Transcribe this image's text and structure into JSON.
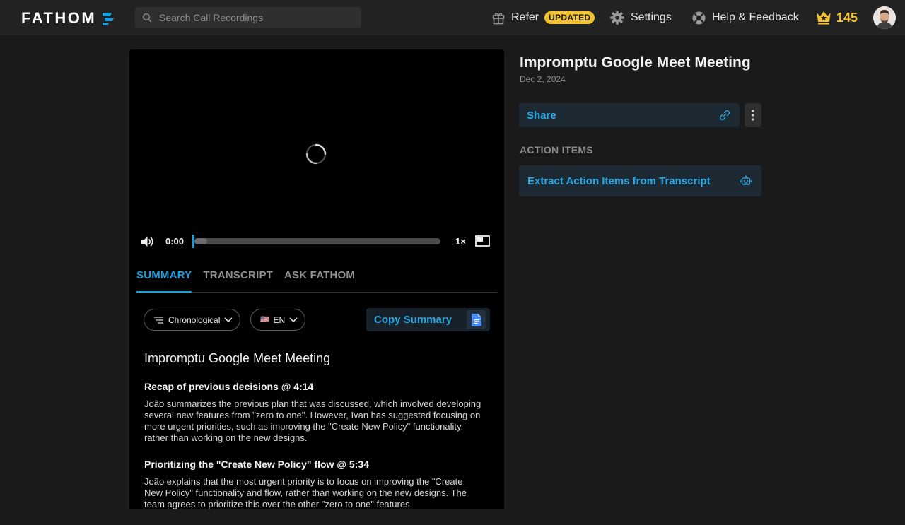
{
  "header": {
    "logo_text": "FATHOM",
    "search_placeholder": "Search Call Recordings",
    "refer_label": "Refer",
    "updated_badge": "UPDATED",
    "settings_label": "Settings",
    "help_label": "Help & Feedback",
    "points": "145"
  },
  "player": {
    "current_time": "0:00",
    "speed": "1×",
    "progress": 0
  },
  "tabs": [
    {
      "label": "SUMMARY",
      "active": true
    },
    {
      "label": "TRANSCRIPT",
      "active": false
    },
    {
      "label": "ASK FATHOM",
      "active": false
    }
  ],
  "filters": {
    "order": "Chronological",
    "language_flag": "🇺🇸",
    "language": "EN"
  },
  "copy_summary_label": "Copy Summary",
  "summary": {
    "title": "Impromptu Google Meet Meeting",
    "sections": [
      {
        "title": "Recap of previous decisions @ 4:14",
        "body": "João summarizes the previous plan that was discussed, which involved developing several new features from \"zero to one\". However, Ivan has suggested focusing on more urgent priorities, such as improving the \"Create New Policy\" functionality, rather than working on the new designs."
      },
      {
        "title": "Prioritizing the \"Create New Policy\" flow @ 5:34",
        "body": "João explains that the most urgent priority is to focus on improving the \"Create New Policy\" functionality and flow, rather than working on the new designs. The team agrees to prioritize this over the other \"zero to one\" features."
      }
    ]
  },
  "meeting": {
    "title": "Impromptu Google Meet Meeting",
    "date": "Dec 2, 2024",
    "share_label": "Share",
    "action_items_label": "ACTION ITEMS",
    "extract_label": "Extract Action Items from Transcript"
  },
  "colors": {
    "accent": "#1e9bdb",
    "gold": "#f4c430",
    "background": "#1a1a1a",
    "topbar": "#222222"
  },
  "icons": {
    "logo_mark": "fathom-logo-icon",
    "search": "search-icon",
    "refer": "gift-icon",
    "settings": "gear-icon",
    "help": "lifebuoy-icon",
    "points": "crown-icon",
    "volume": "volume-icon",
    "pip": "picture-in-picture-icon",
    "order": "sort-lines-icon",
    "dropdown": "chevron-down-icon",
    "doc": "google-docs-icon",
    "link": "link-icon",
    "more": "kebab-menu-icon",
    "robot": "robot-icon"
  }
}
